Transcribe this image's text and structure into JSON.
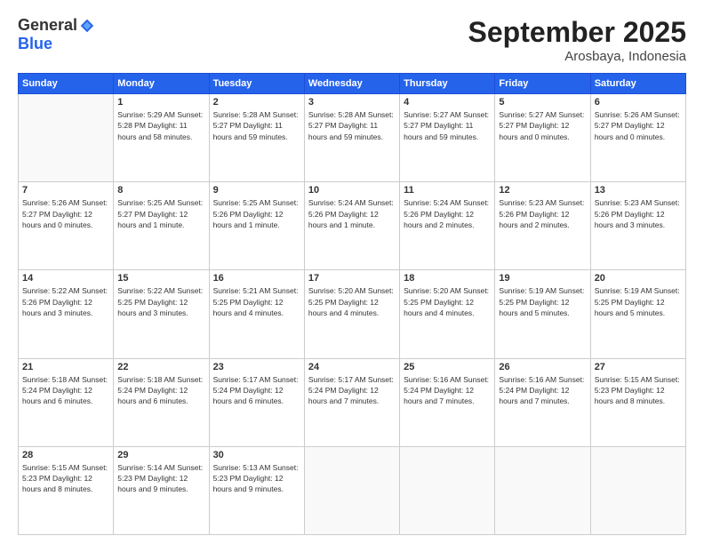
{
  "logo": {
    "general": "General",
    "blue": "Blue"
  },
  "header": {
    "month": "September 2025",
    "location": "Arosbaya, Indonesia"
  },
  "weekdays": [
    "Sunday",
    "Monday",
    "Tuesday",
    "Wednesday",
    "Thursday",
    "Friday",
    "Saturday"
  ],
  "weeks": [
    [
      {
        "day": "",
        "info": ""
      },
      {
        "day": "1",
        "info": "Sunrise: 5:29 AM\nSunset: 5:28 PM\nDaylight: 11 hours\nand 58 minutes."
      },
      {
        "day": "2",
        "info": "Sunrise: 5:28 AM\nSunset: 5:27 PM\nDaylight: 11 hours\nand 59 minutes."
      },
      {
        "day": "3",
        "info": "Sunrise: 5:28 AM\nSunset: 5:27 PM\nDaylight: 11 hours\nand 59 minutes."
      },
      {
        "day": "4",
        "info": "Sunrise: 5:27 AM\nSunset: 5:27 PM\nDaylight: 11 hours\nand 59 minutes."
      },
      {
        "day": "5",
        "info": "Sunrise: 5:27 AM\nSunset: 5:27 PM\nDaylight: 12 hours\nand 0 minutes."
      },
      {
        "day": "6",
        "info": "Sunrise: 5:26 AM\nSunset: 5:27 PM\nDaylight: 12 hours\nand 0 minutes."
      }
    ],
    [
      {
        "day": "7",
        "info": "Sunrise: 5:26 AM\nSunset: 5:27 PM\nDaylight: 12 hours\nand 0 minutes."
      },
      {
        "day": "8",
        "info": "Sunrise: 5:25 AM\nSunset: 5:27 PM\nDaylight: 12 hours\nand 1 minute."
      },
      {
        "day": "9",
        "info": "Sunrise: 5:25 AM\nSunset: 5:26 PM\nDaylight: 12 hours\nand 1 minute."
      },
      {
        "day": "10",
        "info": "Sunrise: 5:24 AM\nSunset: 5:26 PM\nDaylight: 12 hours\nand 1 minute."
      },
      {
        "day": "11",
        "info": "Sunrise: 5:24 AM\nSunset: 5:26 PM\nDaylight: 12 hours\nand 2 minutes."
      },
      {
        "day": "12",
        "info": "Sunrise: 5:23 AM\nSunset: 5:26 PM\nDaylight: 12 hours\nand 2 minutes."
      },
      {
        "day": "13",
        "info": "Sunrise: 5:23 AM\nSunset: 5:26 PM\nDaylight: 12 hours\nand 3 minutes."
      }
    ],
    [
      {
        "day": "14",
        "info": "Sunrise: 5:22 AM\nSunset: 5:26 PM\nDaylight: 12 hours\nand 3 minutes."
      },
      {
        "day": "15",
        "info": "Sunrise: 5:22 AM\nSunset: 5:25 PM\nDaylight: 12 hours\nand 3 minutes."
      },
      {
        "day": "16",
        "info": "Sunrise: 5:21 AM\nSunset: 5:25 PM\nDaylight: 12 hours\nand 4 minutes."
      },
      {
        "day": "17",
        "info": "Sunrise: 5:20 AM\nSunset: 5:25 PM\nDaylight: 12 hours\nand 4 minutes."
      },
      {
        "day": "18",
        "info": "Sunrise: 5:20 AM\nSunset: 5:25 PM\nDaylight: 12 hours\nand 4 minutes."
      },
      {
        "day": "19",
        "info": "Sunrise: 5:19 AM\nSunset: 5:25 PM\nDaylight: 12 hours\nand 5 minutes."
      },
      {
        "day": "20",
        "info": "Sunrise: 5:19 AM\nSunset: 5:25 PM\nDaylight: 12 hours\nand 5 minutes."
      }
    ],
    [
      {
        "day": "21",
        "info": "Sunrise: 5:18 AM\nSunset: 5:24 PM\nDaylight: 12 hours\nand 6 minutes."
      },
      {
        "day": "22",
        "info": "Sunrise: 5:18 AM\nSunset: 5:24 PM\nDaylight: 12 hours\nand 6 minutes."
      },
      {
        "day": "23",
        "info": "Sunrise: 5:17 AM\nSunset: 5:24 PM\nDaylight: 12 hours\nand 6 minutes."
      },
      {
        "day": "24",
        "info": "Sunrise: 5:17 AM\nSunset: 5:24 PM\nDaylight: 12 hours\nand 7 minutes."
      },
      {
        "day": "25",
        "info": "Sunrise: 5:16 AM\nSunset: 5:24 PM\nDaylight: 12 hours\nand 7 minutes."
      },
      {
        "day": "26",
        "info": "Sunrise: 5:16 AM\nSunset: 5:24 PM\nDaylight: 12 hours\nand 7 minutes."
      },
      {
        "day": "27",
        "info": "Sunrise: 5:15 AM\nSunset: 5:23 PM\nDaylight: 12 hours\nand 8 minutes."
      }
    ],
    [
      {
        "day": "28",
        "info": "Sunrise: 5:15 AM\nSunset: 5:23 PM\nDaylight: 12 hours\nand 8 minutes."
      },
      {
        "day": "29",
        "info": "Sunrise: 5:14 AM\nSunset: 5:23 PM\nDaylight: 12 hours\nand 9 minutes."
      },
      {
        "day": "30",
        "info": "Sunrise: 5:13 AM\nSunset: 5:23 PM\nDaylight: 12 hours\nand 9 minutes."
      },
      {
        "day": "",
        "info": ""
      },
      {
        "day": "",
        "info": ""
      },
      {
        "day": "",
        "info": ""
      },
      {
        "day": "",
        "info": ""
      }
    ]
  ]
}
